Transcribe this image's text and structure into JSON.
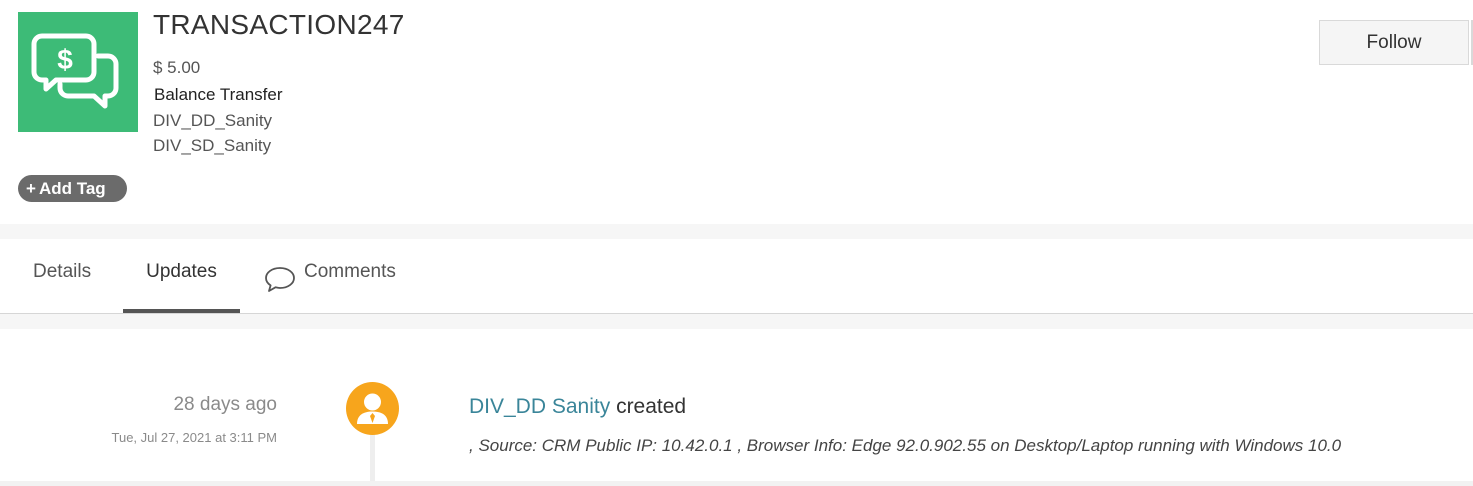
{
  "record": {
    "title": "TRANSACTION247",
    "amount": "$ 5.00",
    "type": "Balance Transfer",
    "owners": [
      "DIV_DD_Sanity",
      "DIV_SD_Sanity"
    ],
    "icon": "money-chat-icon",
    "icon_color": "#3dbb77"
  },
  "actions": {
    "add_tag_label": "Add Tag",
    "follow_label": "Follow"
  },
  "tabs": [
    {
      "label": "Details",
      "active": false
    },
    {
      "label": "Updates",
      "active": true
    },
    {
      "label": "Comments",
      "active": false,
      "icon": "comment-bubble-icon"
    }
  ],
  "updates": [
    {
      "relative_time": "28 days ago",
      "timestamp": "Tue, Jul 27, 2021 at 3:11 PM",
      "actor": "DIV_DD Sanity",
      "action": "created",
      "detail": ", Source: CRM Public IP: 10.42.0.1 , Browser Info: Edge 92.0.902.55 on Desktop/Laptop running with Windows 10.0",
      "avatar_icon": "user-avatar-icon",
      "avatar_color": "#f7a51c"
    }
  ]
}
